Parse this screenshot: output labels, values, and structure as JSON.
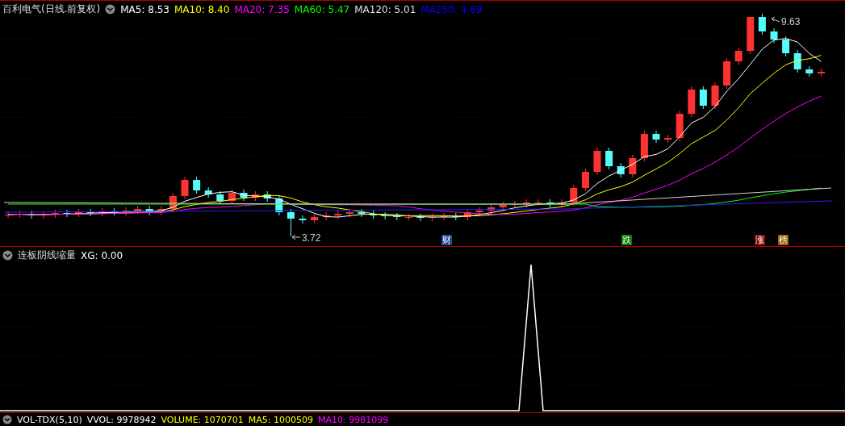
{
  "main_panel": {
    "title": "百利电气(日线.前复权)",
    "indicators": [
      {
        "label": "MA5: 8.53",
        "color": "#ffffff"
      },
      {
        "label": "MA10: 8.40",
        "color": "#ffff00"
      },
      {
        "label": "MA20: 7.35",
        "color": "#ff00ff"
      },
      {
        "label": "MA60: 5.47",
        "color": "#00ff00"
      },
      {
        "label": "MA120: 5.01",
        "color": "#e0e0e0"
      },
      {
        "label": "MA250: 4.69",
        "color": "#0000ff"
      }
    ],
    "high_marker": "9.63",
    "low_marker": "3.72",
    "events": [
      {
        "label": "财",
        "color": "#1e4a8c"
      },
      {
        "label": "跌",
        "color": "#0a7a0a"
      },
      {
        "label": "涨",
        "color": "#8c0a0a"
      },
      {
        "label": "榜",
        "color": "#9c5a0a"
      }
    ]
  },
  "sub_panel": {
    "title": "连板阴线缩量",
    "indicators": [
      {
        "label": "XG: 0.00",
        "color": "#ffffff"
      }
    ]
  },
  "volume_panel": {
    "indicators": [
      {
        "label": "VOL-TDX(5,10)",
        "color": "#ffffff"
      },
      {
        "label": "VVOL: 9978942",
        "color": "#ffffff"
      },
      {
        "label": "VOLUME: 1070701",
        "color": "#ffff00"
      },
      {
        "label": "MA5: 1000509",
        "color": "#ffff00"
      },
      {
        "label": "MA10: 9981099",
        "color": "#ff00ff"
      }
    ]
  }
}
